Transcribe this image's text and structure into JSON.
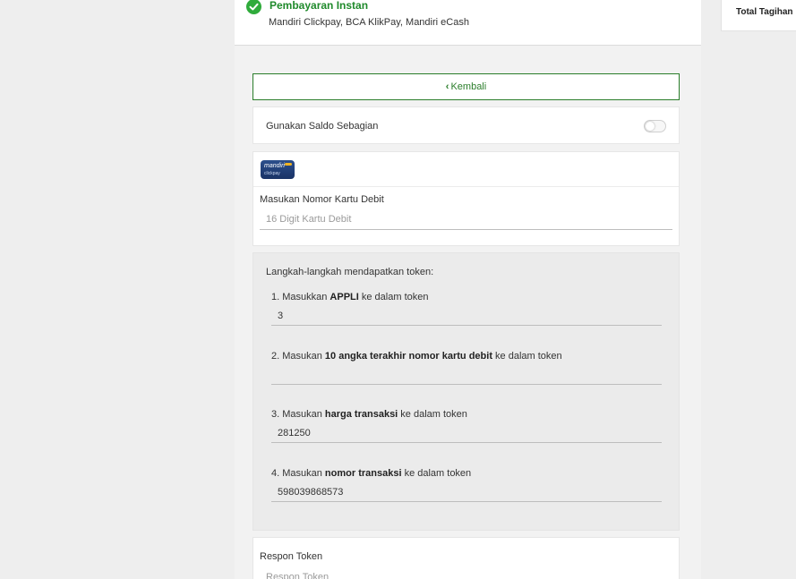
{
  "instant_payment": {
    "title": "Pembayaran Instan",
    "methods": "Mandiri Clickpay, BCA KlikPay, Mandiri eCash",
    "check_icon": "check-circle-icon",
    "accent_color": "#2fab3b"
  },
  "back_button": {
    "label": "Kembali",
    "icon": "chevron-left-icon"
  },
  "saldo": {
    "label": "Gunakan Saldo Sebagian",
    "enabled": false
  },
  "card": {
    "logo_text": "mandiri",
    "logo_sub": "clickpay",
    "debit_label": "Masukan Nomor Kartu Debit",
    "debit_placeholder": "16 Digit Kartu Debit",
    "debit_value": ""
  },
  "token": {
    "heading": "Langkah-langkah mendapatkan token:",
    "steps": [
      {
        "prefix": "1. Masukkan ",
        "bold": "APPLI",
        "suffix": " ke dalam token",
        "value": "3"
      },
      {
        "prefix": "2. Masukan ",
        "bold": "10 angka terakhir nomor kartu debit",
        "suffix": " ke dalam token",
        "value": ""
      },
      {
        "prefix": "3. Masukan ",
        "bold": "harga transaksi",
        "suffix": " ke dalam token",
        "value": "281250"
      },
      {
        "prefix": "4. Masukan ",
        "bold": "nomor transaksi",
        "suffix": " ke dalam token",
        "value": "598039868573"
      }
    ]
  },
  "respon": {
    "label": "Respon Token",
    "placeholder": "Respon Token",
    "value": ""
  },
  "summary": {
    "total_label": "Total Tagihan"
  },
  "colors": {
    "primary_green": "#2a7d2a",
    "title_green": "#1f8a2b",
    "background": "#eeeeee"
  }
}
